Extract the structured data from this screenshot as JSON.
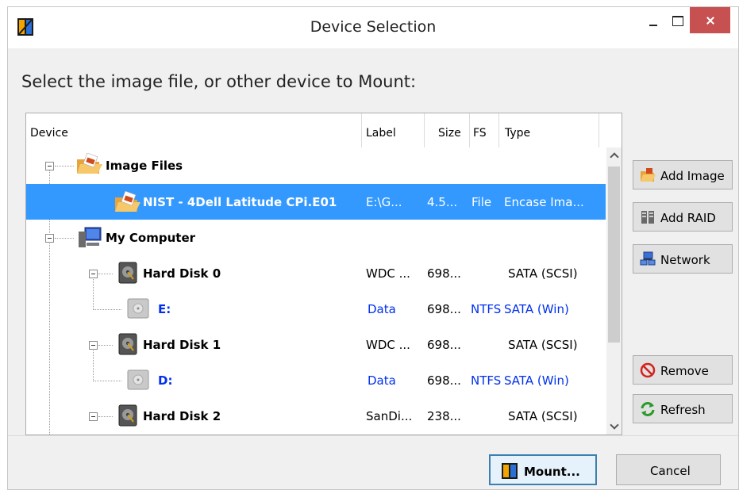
{
  "window": {
    "title": "Device Selection",
    "prompt": "Select the image file, or other device to Mount:"
  },
  "device_list": {
    "columns": [
      "Device",
      "Label",
      "Size",
      "FS",
      "Type"
    ],
    "rows": [
      {
        "name": "Image Files",
        "label": "",
        "size": "",
        "fs": "",
        "type": "",
        "icon": "folder-icon"
      },
      {
        "name": "NIST - 4Dell Latitude CPi.E01",
        "label": "E:\\G...",
        "size": "4.5...",
        "fs": "File",
        "type": "Encase Ima...",
        "icon": "folder-icon",
        "selected": true
      },
      {
        "name": "My Computer",
        "label": "",
        "size": "",
        "fs": "",
        "type": "",
        "icon": "computer-icon"
      },
      {
        "name": "Hard Disk 0",
        "label": "WDC ...",
        "size": "698...",
        "fs": "",
        "type": "SATA (SCSI)",
        "icon": "disk-icon"
      },
      {
        "name": "E:",
        "label": "Data",
        "size": "698...",
        "fs": "NTFS",
        "type": "SATA (Win)",
        "icon": "volume-icon"
      },
      {
        "name": "Hard Disk 1",
        "label": "WDC ...",
        "size": "698...",
        "fs": "",
        "type": "SATA (SCSI)",
        "icon": "disk-icon"
      },
      {
        "name": "D:",
        "label": "Data",
        "size": "698...",
        "fs": "NTFS",
        "type": "SATA (Win)",
        "icon": "volume-icon"
      },
      {
        "name": "Hard Disk 2",
        "label": "SanDi...",
        "size": "238...",
        "fs": "",
        "type": "SATA (SCSI)",
        "icon": "disk-icon"
      }
    ]
  },
  "side_buttons": {
    "add_image": "Add Image",
    "add_raid": "Add RAID",
    "network": "Network",
    "remove": "Remove",
    "refresh": "Refresh"
  },
  "footer": {
    "mount": "Mount...",
    "cancel": "Cancel"
  },
  "colors": {
    "selection": "#3399ff",
    "close_button": "#c75050",
    "volume_text": "#0030ee"
  }
}
